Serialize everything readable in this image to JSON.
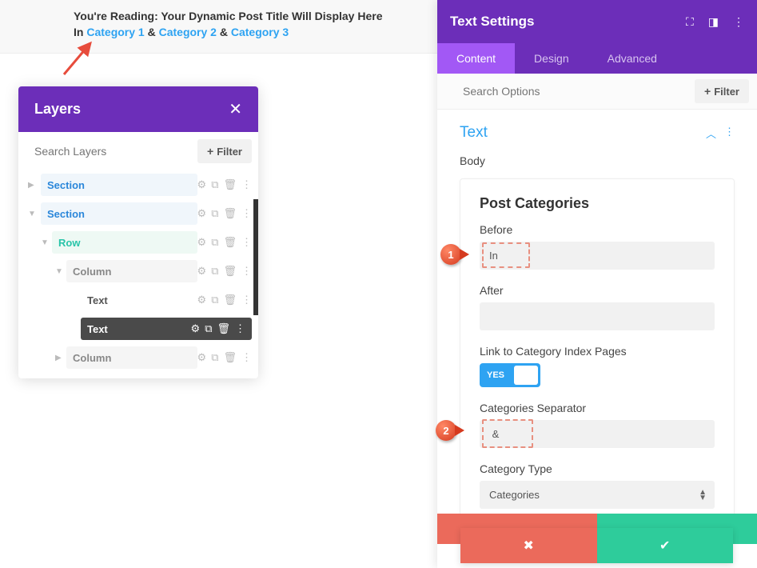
{
  "preview": {
    "line1": "You're Reading: Your Dynamic Post Title Will Display Here",
    "before_text": "In ",
    "cat1": "Category 1",
    "cat2": "Category 2",
    "cat3": "Category 3",
    "amp": " & "
  },
  "layers": {
    "title": "Layers",
    "search_placeholder": "Search Layers",
    "filter_label": "Filter",
    "items": {
      "section1": "Section",
      "section2": "Section",
      "row": "Row",
      "col1": "Column",
      "text1": "Text",
      "text2": "Text",
      "col2": "Column"
    }
  },
  "settings": {
    "title": "Text Settings",
    "tabs": {
      "content": "Content",
      "design": "Design",
      "advanced": "Advanced"
    },
    "search_placeholder": "Search Options",
    "filter_label": "Filter",
    "section_title": "Text",
    "body_label": "Body",
    "pc": {
      "title": "Post Categories",
      "before_label": "Before",
      "before_val": "In ",
      "after_label": "After",
      "after_val": "",
      "link_label": "Link to Category Index Pages",
      "toggle_yes": "YES",
      "sep_label": "Categories Separator",
      "sep_val": " & ",
      "type_label": "Category Type",
      "type_val": "Categories"
    }
  },
  "callouts": {
    "c1": "1",
    "c2": "2"
  }
}
